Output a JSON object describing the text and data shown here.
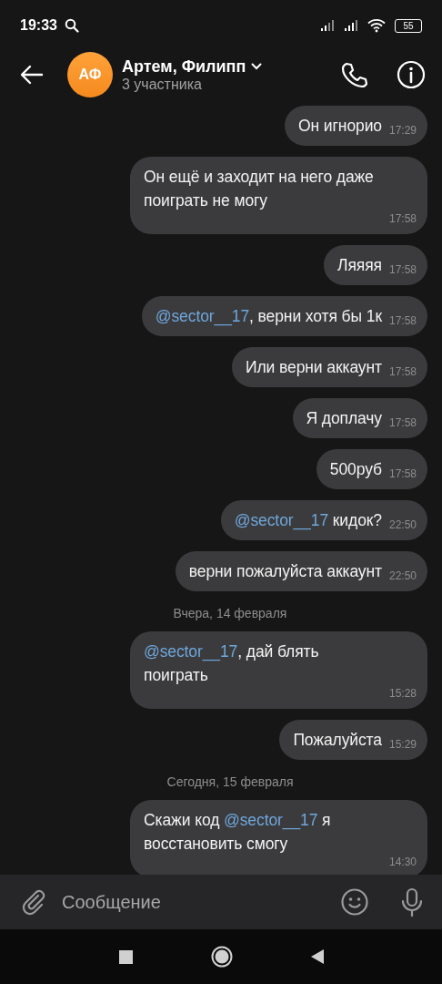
{
  "status_bar": {
    "time": "19:33",
    "battery": "55"
  },
  "header": {
    "avatar_initials": "АФ",
    "title": "Артем, Филипп",
    "subtitle": "3 участника"
  },
  "messages": [
    {
      "kind": "message",
      "parts": [
        {
          "kind": "text",
          "text": "Он игнорио"
        }
      ],
      "time": "17:29"
    },
    {
      "kind": "message",
      "parts": [
        {
          "kind": "text",
          "text": "Он ещё и заходит на него даже поиграть не могу"
        }
      ],
      "time": "17:58"
    },
    {
      "kind": "message",
      "parts": [
        {
          "kind": "text",
          "text": "Ляяяя"
        }
      ],
      "time": "17:58"
    },
    {
      "kind": "message",
      "parts": [
        {
          "kind": "mention",
          "text": "@sector__17"
        },
        {
          "kind": "text",
          "text": ", верни хотя бы 1к"
        }
      ],
      "time": "17:58"
    },
    {
      "kind": "message",
      "parts": [
        {
          "kind": "text",
          "text": "Или верни аккаунт"
        }
      ],
      "time": "17:58"
    },
    {
      "kind": "message",
      "parts": [
        {
          "kind": "text",
          "text": "Я доплачу"
        }
      ],
      "time": "17:58"
    },
    {
      "kind": "message",
      "parts": [
        {
          "kind": "text",
          "text": "500руб"
        }
      ],
      "time": "17:58"
    },
    {
      "kind": "message",
      "parts": [
        {
          "kind": "mention",
          "text": "@sector__17"
        },
        {
          "kind": "text",
          "text": " кидок?"
        }
      ],
      "time": "22:50"
    },
    {
      "kind": "message",
      "parts": [
        {
          "kind": "text",
          "text": "верни пожалуйста аккаунт"
        }
      ],
      "time": "22:50"
    },
    {
      "kind": "date",
      "text": "Вчера, 14 февраля"
    },
    {
      "kind": "message",
      "parts": [
        {
          "kind": "mention",
          "text": "@sector__17"
        },
        {
          "kind": "text",
          "text": ",  дай блять поиграть"
        }
      ],
      "time": "15:28"
    },
    {
      "kind": "message",
      "parts": [
        {
          "kind": "text",
          "text": "Пожалуйста"
        }
      ],
      "time": "15:29"
    },
    {
      "kind": "date",
      "text": "Сегодня, 15 февраля"
    },
    {
      "kind": "message",
      "parts": [
        {
          "kind": "text",
          "text": "Скажи код "
        },
        {
          "kind": "mention",
          "text": "@sector__17"
        },
        {
          "kind": "text",
          "text": " я восстановить смогу"
        }
      ],
      "time": "14:30"
    }
  ],
  "composer": {
    "placeholder": "Сообщение"
  }
}
